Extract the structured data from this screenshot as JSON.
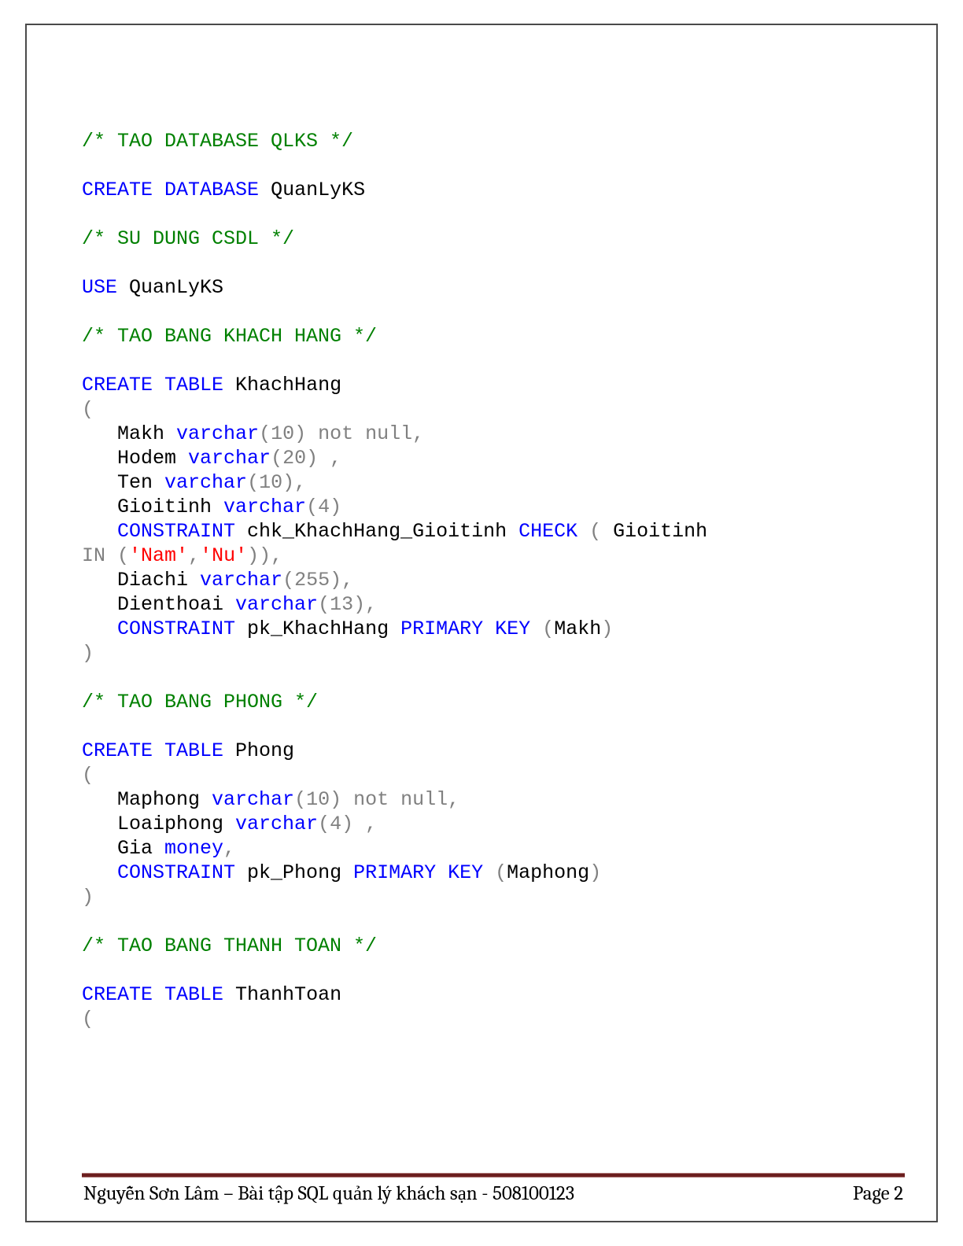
{
  "footer": {
    "left": "Nguyễn Sơn Lâm – Bài tập SQL quản lý khách sạn - 508100123",
    "right": "Page 2"
  },
  "code": {
    "l01": "/* TAO DATABASE QLKS */",
    "l02a": "CREATE",
    "l02b": "DATABASE",
    "l02c": " QuanLyKS",
    "l03": "/* SU DUNG CSDL */",
    "l04a": "USE",
    "l04b": " QuanLyKS",
    "l05": "/* TAO BANG KHACH HANG */",
    "l06a": "CREATE",
    "l06b": "TABLE",
    "l06c": " KhachHang",
    "l07": "(",
    "l08a": "   Makh ",
    "l08b": "varchar",
    "l08c": "(",
    "l08d": "10",
    "l08e": ")",
    "l08f": "not",
    "l08g": "null,",
    "l09a": "   Hodem ",
    "l09b": "varchar",
    "l09c": "(",
    "l09d": "20",
    "l09e": ")",
    "l09f": ",",
    "l10a": "   Ten ",
    "l10b": "varchar",
    "l10c": "(",
    "l10d": "10",
    "l10e": "),",
    "l11a": "   Gioitinh ",
    "l11b": "varchar",
    "l11c": "(",
    "l11d": "4",
    "l11e": ")",
    "l12a": "CONSTRAINT",
    "l12b": " chk_KhachHang_Gioitinh ",
    "l12c": "CHECK",
    "l12d": "(",
    "l12e": " Gioitinh",
    "l13a": "IN",
    "l13b": "(",
    "l13c": "'Nam'",
    "l13d": ",",
    "l13e": "'Nu'",
    "l13f": ")),",
    "l14a": "   Diachi ",
    "l14b": "varchar",
    "l14c": "(",
    "l14d": "255",
    "l14e": "),",
    "l15a": "   Dienthoai ",
    "l15b": "varchar",
    "l15c": "(",
    "l15d": "13",
    "l15e": "),",
    "l16a": "CONSTRAINT",
    "l16b": " pk_KhachHang ",
    "l16c": "PRIMARY",
    "l16d": "KEY",
    "l16e": "(",
    "l16f": "Makh",
    "l16g": ")",
    "l17": ")",
    "l18": "/* TAO BANG PHONG */",
    "l19a": "CREATE",
    "l19b": "TABLE",
    "l19c": " Phong",
    "l20": "(",
    "l21a": "   Maphong ",
    "l21b": "varchar",
    "l21c": "(",
    "l21d": "10",
    "l21e": ")",
    "l21f": "not",
    "l21g": "null,",
    "l22a": "   Loaiphong ",
    "l22b": "varchar",
    "l22c": "(",
    "l22d": "4",
    "l22e": ")",
    "l22f": ",",
    "l23a": "   Gia ",
    "l23b": "money",
    "l23c": ",",
    "l24a": "CONSTRAINT",
    "l24b": " pk_Phong ",
    "l24c": "PRIMARY",
    "l24d": "KEY",
    "l24e": "(",
    "l24f": "Maphong",
    "l24g": ")",
    "l25": ")",
    "l26": "/* TAO BANG THANH TOAN */",
    "l27a": "CREATE",
    "l27b": "TABLE",
    "l27c": " ThanhToan",
    "l28": "("
  }
}
